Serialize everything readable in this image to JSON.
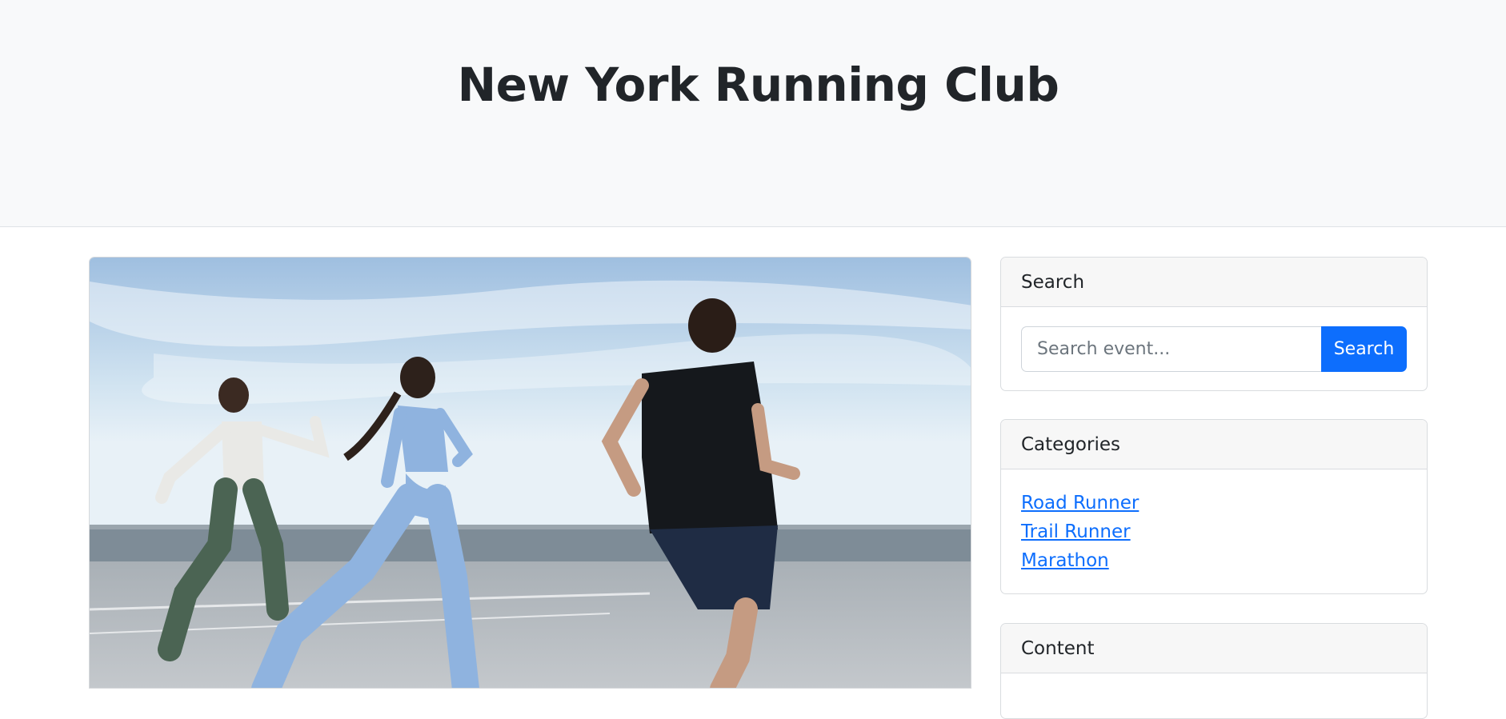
{
  "header": {
    "title": "New York Running Club"
  },
  "search": {
    "heading": "Search",
    "placeholder": "Search event...",
    "button_label": "Search"
  },
  "categories": {
    "heading": "Categories",
    "items": [
      "Road Runner",
      "Trail Runner",
      "Marathon"
    ]
  },
  "content": {
    "heading": "Content"
  },
  "colors": {
    "header_bg": "#f8f9fa",
    "primary": "#0d6efd",
    "card_header_bg": "#f7f7f7"
  }
}
